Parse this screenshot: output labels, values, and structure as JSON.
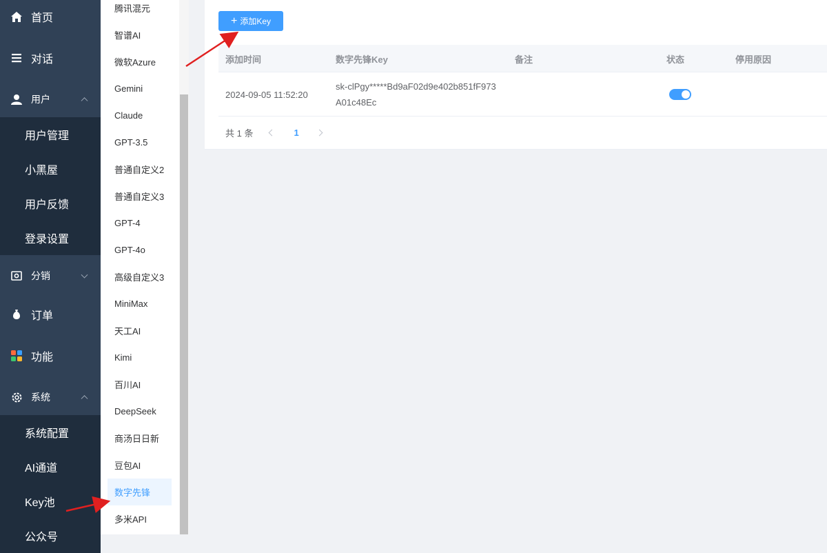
{
  "nav": {
    "home": "首页",
    "chat": "对话",
    "user": "用户",
    "user_sub": [
      "用户管理",
      "小黑屋",
      "用户反馈",
      "登录设置"
    ],
    "distribution": "分销",
    "orders": "订单",
    "features": "功能",
    "system": "系统",
    "system_sub": [
      "系统配置",
      "AI通道",
      "Key池",
      "公众号"
    ]
  },
  "menu2": {
    "items": [
      "腾讯混元",
      "智谱AI",
      "微软Azure",
      "Gemini",
      "Claude",
      "GPT-3.5",
      "普通自定义2",
      "普通自定义3",
      "GPT-4",
      "GPT-4o",
      "高级自定义3",
      "MiniMax",
      "天工AI",
      "Kimi",
      "百川AI",
      "DeepSeek",
      "商汤日日新",
      "豆包AI",
      "数字先锋",
      "多米API"
    ],
    "active": "数字先锋"
  },
  "toolbar": {
    "add_label": "添加Key",
    "add_icon": "plus-icon"
  },
  "table": {
    "columns": [
      "添加时间",
      "数字先锋Key",
      "备注",
      "状态",
      "停用原因"
    ],
    "rows": [
      {
        "added": "2024-09-05 11:52:20",
        "key": "sk-clPgy*****Bd9aF02d9e402b851fF973A01c48Ec",
        "note": "",
        "status": true,
        "reason": ""
      }
    ]
  },
  "pagination": {
    "total_text": "共 1 条",
    "current": "1"
  },
  "colors": {
    "nav_bg": "#304156",
    "sub_bg": "#1f2d3d",
    "accent": "#409eff",
    "annotation": "#e02020"
  }
}
